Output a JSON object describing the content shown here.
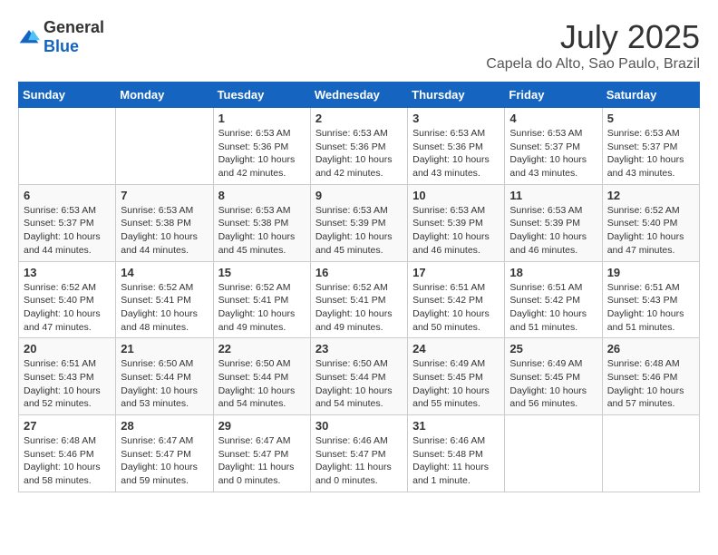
{
  "header": {
    "logo_general": "General",
    "logo_blue": "Blue",
    "month_title": "July 2025",
    "location": "Capela do Alto, Sao Paulo, Brazil"
  },
  "calendar": {
    "weekdays": [
      "Sunday",
      "Monday",
      "Tuesday",
      "Wednesday",
      "Thursday",
      "Friday",
      "Saturday"
    ],
    "weeks": [
      [
        {
          "day": "",
          "info": ""
        },
        {
          "day": "",
          "info": ""
        },
        {
          "day": "1",
          "info": "Sunrise: 6:53 AM\nSunset: 5:36 PM\nDaylight: 10 hours and 42 minutes."
        },
        {
          "day": "2",
          "info": "Sunrise: 6:53 AM\nSunset: 5:36 PM\nDaylight: 10 hours and 42 minutes."
        },
        {
          "day": "3",
          "info": "Sunrise: 6:53 AM\nSunset: 5:36 PM\nDaylight: 10 hours and 43 minutes."
        },
        {
          "day": "4",
          "info": "Sunrise: 6:53 AM\nSunset: 5:37 PM\nDaylight: 10 hours and 43 minutes."
        },
        {
          "day": "5",
          "info": "Sunrise: 6:53 AM\nSunset: 5:37 PM\nDaylight: 10 hours and 43 minutes."
        }
      ],
      [
        {
          "day": "6",
          "info": "Sunrise: 6:53 AM\nSunset: 5:37 PM\nDaylight: 10 hours and 44 minutes."
        },
        {
          "day": "7",
          "info": "Sunrise: 6:53 AM\nSunset: 5:38 PM\nDaylight: 10 hours and 44 minutes."
        },
        {
          "day": "8",
          "info": "Sunrise: 6:53 AM\nSunset: 5:38 PM\nDaylight: 10 hours and 45 minutes."
        },
        {
          "day": "9",
          "info": "Sunrise: 6:53 AM\nSunset: 5:39 PM\nDaylight: 10 hours and 45 minutes."
        },
        {
          "day": "10",
          "info": "Sunrise: 6:53 AM\nSunset: 5:39 PM\nDaylight: 10 hours and 46 minutes."
        },
        {
          "day": "11",
          "info": "Sunrise: 6:53 AM\nSunset: 5:39 PM\nDaylight: 10 hours and 46 minutes."
        },
        {
          "day": "12",
          "info": "Sunrise: 6:52 AM\nSunset: 5:40 PM\nDaylight: 10 hours and 47 minutes."
        }
      ],
      [
        {
          "day": "13",
          "info": "Sunrise: 6:52 AM\nSunset: 5:40 PM\nDaylight: 10 hours and 47 minutes."
        },
        {
          "day": "14",
          "info": "Sunrise: 6:52 AM\nSunset: 5:41 PM\nDaylight: 10 hours and 48 minutes."
        },
        {
          "day": "15",
          "info": "Sunrise: 6:52 AM\nSunset: 5:41 PM\nDaylight: 10 hours and 49 minutes."
        },
        {
          "day": "16",
          "info": "Sunrise: 6:52 AM\nSunset: 5:41 PM\nDaylight: 10 hours and 49 minutes."
        },
        {
          "day": "17",
          "info": "Sunrise: 6:51 AM\nSunset: 5:42 PM\nDaylight: 10 hours and 50 minutes."
        },
        {
          "day": "18",
          "info": "Sunrise: 6:51 AM\nSunset: 5:42 PM\nDaylight: 10 hours and 51 minutes."
        },
        {
          "day": "19",
          "info": "Sunrise: 6:51 AM\nSunset: 5:43 PM\nDaylight: 10 hours and 51 minutes."
        }
      ],
      [
        {
          "day": "20",
          "info": "Sunrise: 6:51 AM\nSunset: 5:43 PM\nDaylight: 10 hours and 52 minutes."
        },
        {
          "day": "21",
          "info": "Sunrise: 6:50 AM\nSunset: 5:44 PM\nDaylight: 10 hours and 53 minutes."
        },
        {
          "day": "22",
          "info": "Sunrise: 6:50 AM\nSunset: 5:44 PM\nDaylight: 10 hours and 54 minutes."
        },
        {
          "day": "23",
          "info": "Sunrise: 6:50 AM\nSunset: 5:44 PM\nDaylight: 10 hours and 54 minutes."
        },
        {
          "day": "24",
          "info": "Sunrise: 6:49 AM\nSunset: 5:45 PM\nDaylight: 10 hours and 55 minutes."
        },
        {
          "day": "25",
          "info": "Sunrise: 6:49 AM\nSunset: 5:45 PM\nDaylight: 10 hours and 56 minutes."
        },
        {
          "day": "26",
          "info": "Sunrise: 6:48 AM\nSunset: 5:46 PM\nDaylight: 10 hours and 57 minutes."
        }
      ],
      [
        {
          "day": "27",
          "info": "Sunrise: 6:48 AM\nSunset: 5:46 PM\nDaylight: 10 hours and 58 minutes."
        },
        {
          "day": "28",
          "info": "Sunrise: 6:47 AM\nSunset: 5:47 PM\nDaylight: 10 hours and 59 minutes."
        },
        {
          "day": "29",
          "info": "Sunrise: 6:47 AM\nSunset: 5:47 PM\nDaylight: 11 hours and 0 minutes."
        },
        {
          "day": "30",
          "info": "Sunrise: 6:46 AM\nSunset: 5:47 PM\nDaylight: 11 hours and 0 minutes."
        },
        {
          "day": "31",
          "info": "Sunrise: 6:46 AM\nSunset: 5:48 PM\nDaylight: 11 hours and 1 minute."
        },
        {
          "day": "",
          "info": ""
        },
        {
          "day": "",
          "info": ""
        }
      ]
    ]
  }
}
